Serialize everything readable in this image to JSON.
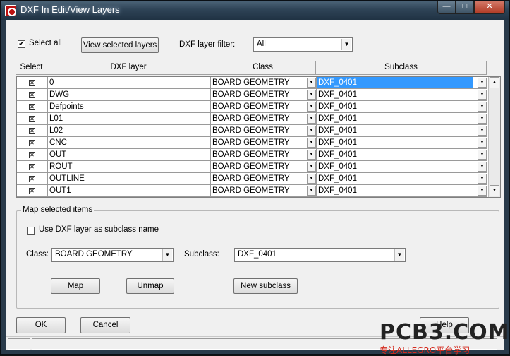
{
  "window": {
    "title": "DXF In Edit/View Layers",
    "caption_min": "—",
    "caption_max": "□",
    "caption_close": "✕"
  },
  "toolbar": {
    "select_all_label": "Select all",
    "select_all_checked": true,
    "view_selected_label": "View selected layers",
    "filter_label": "DXF layer filter:",
    "filter_value": "All"
  },
  "table": {
    "headers": [
      "Select",
      "DXF layer",
      "Class",
      "Subclass"
    ],
    "rows": [
      {
        "layer": "0",
        "class": "BOARD GEOMETRY",
        "subclass": "DXF_0401",
        "selected": true
      },
      {
        "layer": "DWG",
        "class": "BOARD GEOMETRY",
        "subclass": "DXF_0401",
        "selected": true
      },
      {
        "layer": "Defpoints",
        "class": "BOARD GEOMETRY",
        "subclass": "DXF_0401",
        "selected": true
      },
      {
        "layer": "L01",
        "class": "BOARD GEOMETRY",
        "subclass": "DXF_0401",
        "selected": true
      },
      {
        "layer": "L02",
        "class": "BOARD GEOMETRY",
        "subclass": "DXF_0401",
        "selected": true
      },
      {
        "layer": "CNC",
        "class": "BOARD GEOMETRY",
        "subclass": "DXF_0401",
        "selected": true
      },
      {
        "layer": "OUT",
        "class": "BOARD GEOMETRY",
        "subclass": "DXF_0401",
        "selected": true
      },
      {
        "layer": "ROUT",
        "class": "BOARD GEOMETRY",
        "subclass": "DXF_0401",
        "selected": true
      },
      {
        "layer": "OUTLINE",
        "class": "BOARD GEOMETRY",
        "subclass": "DXF_0401",
        "selected": true
      },
      {
        "layer": "OUT1",
        "class": "BOARD GEOMETRY",
        "subclass": "DXF_0401",
        "selected": true
      }
    ]
  },
  "map_group": {
    "title": "Map selected items",
    "use_layer_label": "Use DXF layer as subclass name",
    "use_layer_checked": false,
    "class_label": "Class:",
    "class_value": "BOARD GEOMETRY",
    "subclass_label": "Subclass:",
    "subclass_value": "DXF_0401",
    "map_label": "Map",
    "unmap_label": "Unmap",
    "new_subclass_label": "New subclass"
  },
  "footer": {
    "ok_label": "OK",
    "cancel_label": "Cancel",
    "help_label": "Help"
  },
  "watermark": {
    "brand": "PCB3.COM",
    "tagline": "专注ALLEGRO平台学习"
  },
  "colors": {
    "selection": "#3399ff",
    "titlebar": "#2e4356",
    "close": "#c44a33",
    "watermark_red": "#d42a1e"
  }
}
